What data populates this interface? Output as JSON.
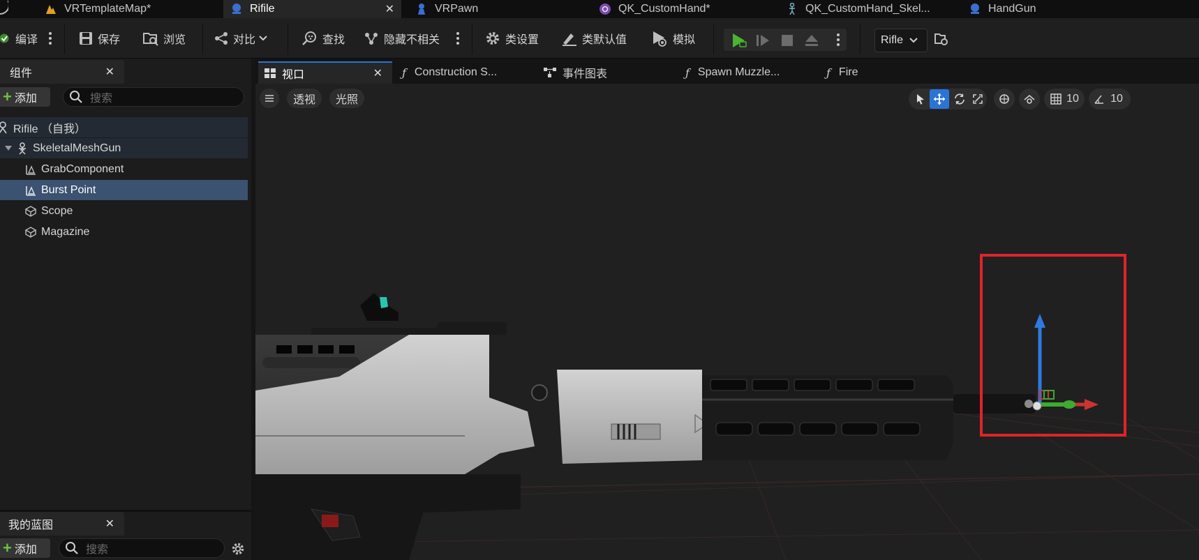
{
  "document_tabs": [
    {
      "label": "VRTemplateMap*",
      "icon": "map-icon",
      "active": false
    },
    {
      "label": "Rifile",
      "icon": "blueprint-icon",
      "active": true
    },
    {
      "label": "VRPawn",
      "icon": "pawn-icon",
      "active": false
    },
    {
      "label": "QK_CustomHand*",
      "icon": "anim-blueprint-icon",
      "active": false
    },
    {
      "label": "QK_CustomHand_Skel...",
      "icon": "skeleton-icon",
      "active": false
    },
    {
      "label": "HandGun",
      "icon": "blueprint-icon",
      "active": false
    }
  ],
  "toolbar": {
    "compile_label": "编译",
    "save_label": "保存",
    "browse_label": "浏览",
    "diff_label": "对比",
    "find_label": "查找",
    "hide_unrelated_label": "隐藏不相关",
    "class_settings_label": "类设置",
    "class_defaults_label": "类默认值",
    "simulate_label": "模拟",
    "debug_object_label": "Rifle"
  },
  "components_panel": {
    "title": "组件",
    "add_label": "添加",
    "search_placeholder": "搜索",
    "items": [
      {
        "label": "Rifile （自我）",
        "icon": "actor-icon",
        "depth": 0
      },
      {
        "label": "SkeletalMeshGun",
        "icon": "skeletal-mesh-icon",
        "depth": 1
      },
      {
        "label": "GrabComponent",
        "icon": "scene-component-icon",
        "depth": 2
      },
      {
        "label": "Burst Point",
        "icon": "scene-component-icon",
        "depth": 2,
        "selected": true
      },
      {
        "label": "Scope",
        "icon": "static-mesh-icon",
        "depth": 2
      },
      {
        "label": "Magazine",
        "icon": "static-mesh-icon",
        "depth": 2
      }
    ]
  },
  "my_blueprint_panel": {
    "title": "我的蓝图",
    "add_label": "添加",
    "search_placeholder": "搜索"
  },
  "editor_tabs": [
    {
      "label": "视口",
      "icon": "viewport-icon",
      "active": true
    },
    {
      "label": "Construction S...",
      "icon": "function-icon"
    },
    {
      "label": "事件图表",
      "icon": "event-graph-icon"
    },
    {
      "label": "Spawn Muzzle...",
      "icon": "function-icon"
    },
    {
      "label": "Fire",
      "icon": "function-icon"
    }
  ],
  "viewport": {
    "view_mode_label": "透视",
    "lighting_label": "光照",
    "grid_snap_value": "10",
    "rotation_snap_value": "10",
    "highlight_color": "#e0232a",
    "accent_color": "#2b74d6"
  }
}
